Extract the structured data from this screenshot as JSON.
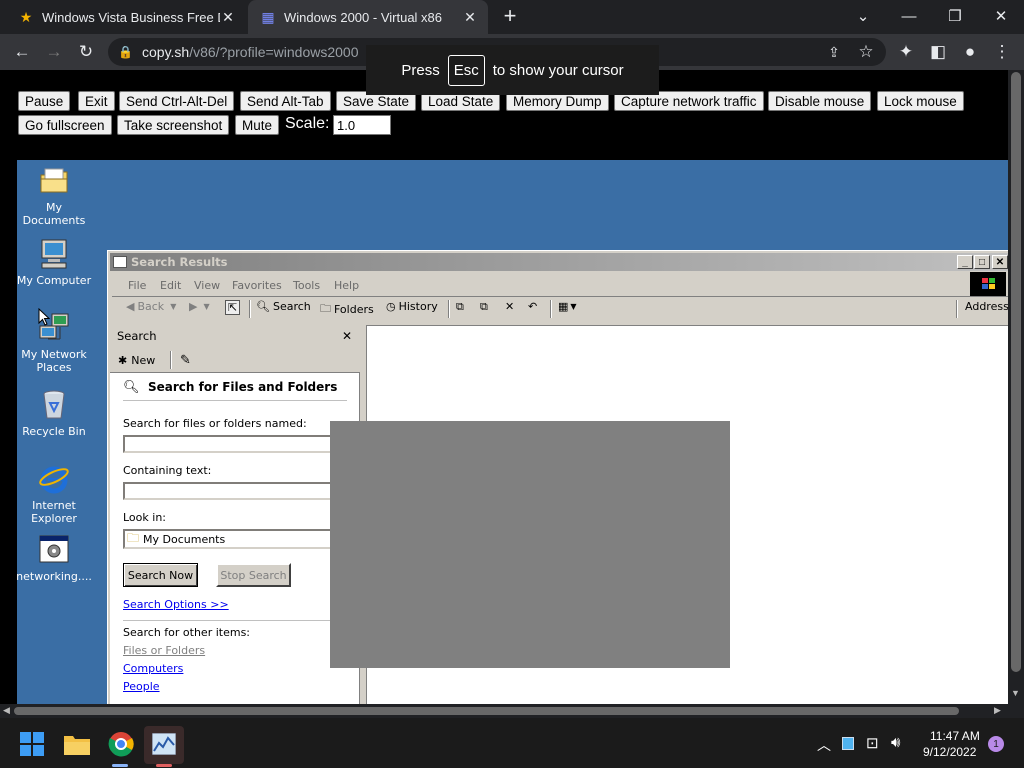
{
  "browser": {
    "tabs": [
      {
        "title": "Windows Vista Business Free Dow",
        "icon": "star-icon"
      },
      {
        "title": "Windows 2000 - Virtual x86",
        "icon": "v86-icon"
      }
    ],
    "url_host": "copy.sh",
    "url_path": "/v86/?profile=windows2000"
  },
  "cursor_tip": {
    "press": "Press",
    "key": "Esc",
    "rest": "to show your cursor"
  },
  "controls": {
    "buttons": [
      "Pause",
      "Exit",
      "Send Ctrl-Alt-Del",
      "Send Alt-Tab",
      "Save State",
      "Load State",
      "Memory Dump",
      "Capture network traffic",
      "Disable mouse",
      "Lock mouse",
      "Go fullscreen",
      "Take screenshot",
      "Mute"
    ],
    "scale_label": "Scale:",
    "scale_value": "1.0"
  },
  "desktop": {
    "icons": [
      "My Documents",
      "My Computer",
      "My Network Places",
      "Recycle Bin",
      "Internet Explorer",
      "networking...."
    ]
  },
  "window": {
    "title": "Search Results",
    "menu": [
      "File",
      "Edit",
      "View",
      "Favorites",
      "Tools",
      "Help"
    ],
    "toolbar": {
      "back": "Back",
      "search": "Search",
      "folders": "Folders",
      "history": "History",
      "address": "Address"
    },
    "search_pane": {
      "header": "Search",
      "new": "New",
      "heading": "Search for Files and Folders",
      "named_label": "Search for files or folders named:",
      "containing_label": "Containing text:",
      "lookin_label": "Look in:",
      "lookin_value": "My Documents",
      "search_now": "Search Now",
      "stop_search": "Stop Search",
      "options_link": "Search Options >>",
      "other_label": "Search for other items:",
      "other_items": [
        "Files or Folders",
        "Computers",
        "People"
      ]
    }
  },
  "taskbar": {
    "time": "11:47 AM",
    "date": "9/12/2022",
    "notifications": "1"
  }
}
